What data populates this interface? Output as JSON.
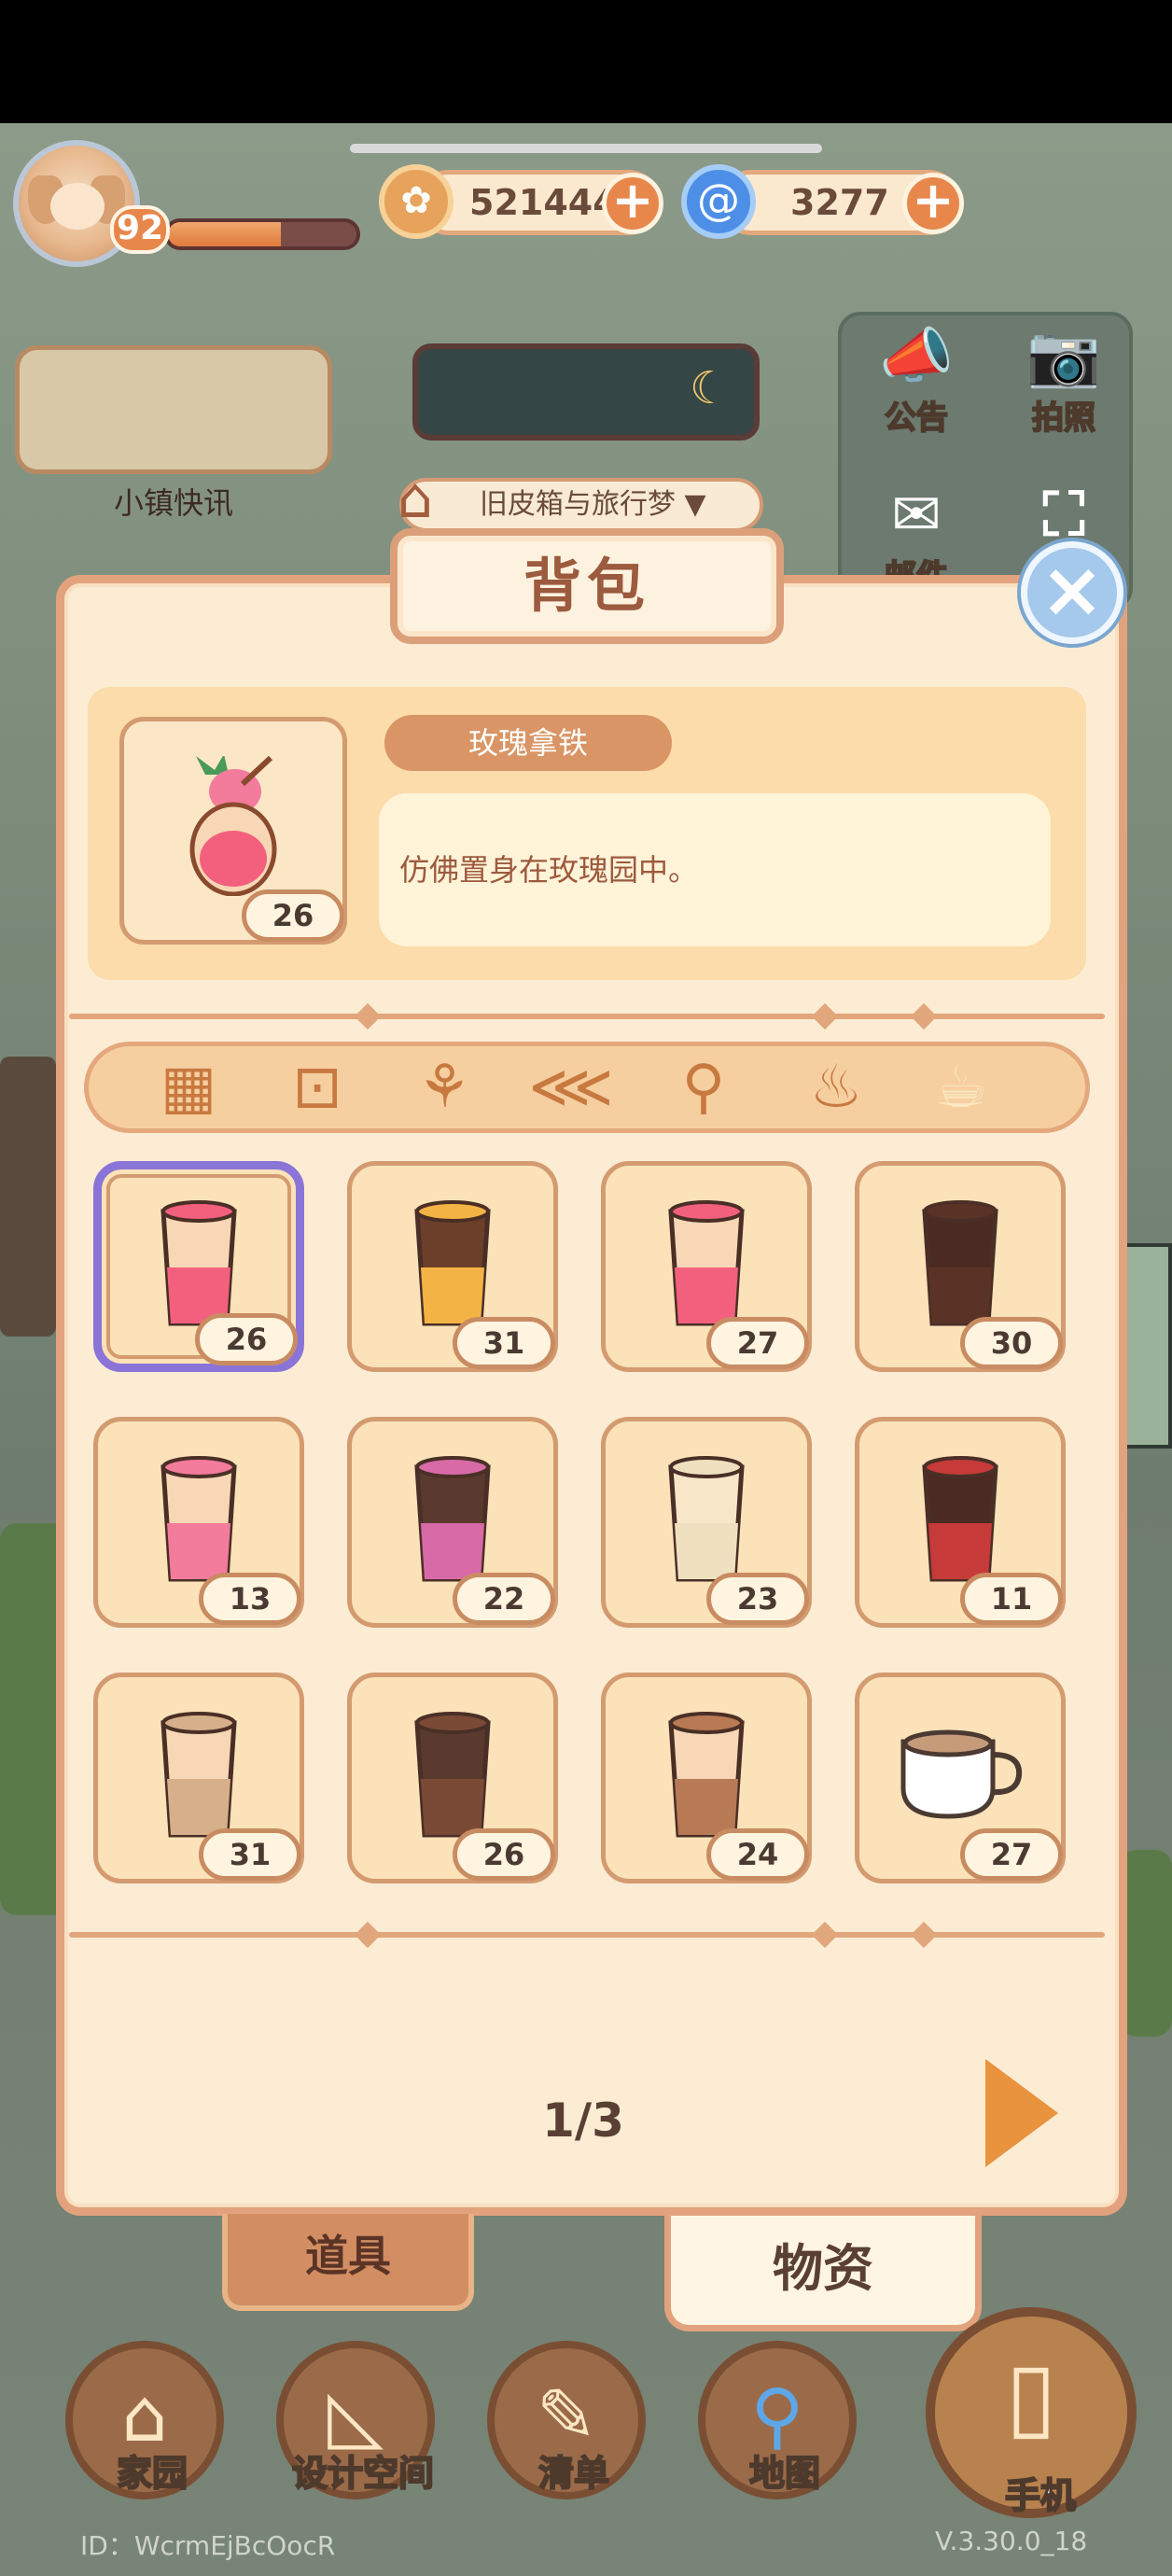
{
  "hud": {
    "level": "92",
    "exp_progress": 0.6,
    "coins": "521444",
    "gems": "3277",
    "town_news_label": "小镇快讯",
    "scene_selector": "旧皮箱与旅行梦",
    "announce_label": "公告",
    "photo_label": "拍照",
    "mail_label": "邮件"
  },
  "backpack": {
    "title": "背包",
    "selected_item": {
      "name": "玫瑰拿铁",
      "description": "仿佛置身在玫瑰园中。",
      "count": "26"
    },
    "categories": [
      {
        "icon": "grid-icon"
      },
      {
        "icon": "seed-packet-icon"
      },
      {
        "icon": "plant-icon"
      },
      {
        "icon": "fish-icon"
      },
      {
        "icon": "drumstick-icon"
      },
      {
        "icon": "soup-bowl-icon"
      },
      {
        "icon": "coffee-cup-icon"
      }
    ],
    "items": [
      {
        "icon": "rose-latte-icon",
        "count": "26"
      },
      {
        "icon": "citrus-coffee-icon",
        "count": "31"
      },
      {
        "icon": "strawberry-latte-icon",
        "count": "27"
      },
      {
        "icon": "iced-coffee-icon",
        "count": "30"
      },
      {
        "icon": "sakura-latte-icon",
        "count": "13"
      },
      {
        "icon": "berry-iced-coffee-icon",
        "count": "22"
      },
      {
        "icon": "flower-latte-icon",
        "count": "23"
      },
      {
        "icon": "raspberry-iced-coffee-icon",
        "count": "11"
      },
      {
        "icon": "latte-icon",
        "count": "31"
      },
      {
        "icon": "cinnamon-mocha-icon",
        "count": "26"
      },
      {
        "icon": "mocha-icon",
        "count": "24"
      },
      {
        "icon": "coffee-mug-icon",
        "count": "27"
      }
    ],
    "pager": "1/3",
    "tab_tools": "道具",
    "tab_materials": "物资"
  },
  "nav": {
    "home": "家园",
    "design": "设计空间",
    "list": "清单",
    "map": "地图",
    "phone": "手机"
  },
  "footer": {
    "id": "ID：WcrmEjBcOocR",
    "version": "V.3.30.0_18"
  },
  "colors": {
    "accent": "#e8874b",
    "panel": "#fbecd3",
    "border": "#e2a27d",
    "selected": "#8a74d8"
  }
}
